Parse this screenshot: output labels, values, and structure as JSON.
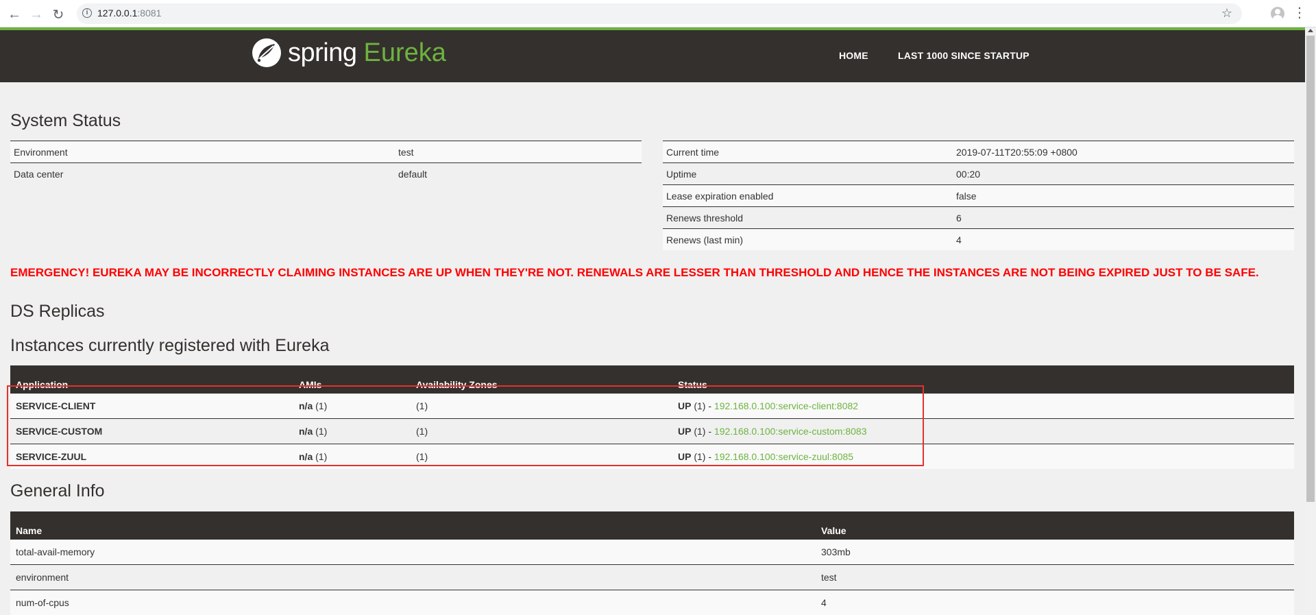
{
  "browser": {
    "url_host": "127.0.0.1",
    "url_port": ":8081"
  },
  "header": {
    "logo_spring": "spring",
    "logo_eureka": "Eureka",
    "nav": [
      "HOME",
      "LAST 1000 SINCE STARTUP"
    ]
  },
  "system_status": {
    "title": "System Status",
    "left": [
      {
        "key": "Environment",
        "value": "test"
      },
      {
        "key": "Data center",
        "value": "default"
      }
    ],
    "right": [
      {
        "key": "Current time",
        "value": "2019-07-11T20:55:09 +0800"
      },
      {
        "key": "Uptime",
        "value": "00:20"
      },
      {
        "key": "Lease expiration enabled",
        "value": "false"
      },
      {
        "key": "Renews threshold",
        "value": "6"
      },
      {
        "key": "Renews (last min)",
        "value": "4"
      }
    ]
  },
  "emergency": "EMERGENCY! EUREKA MAY BE INCORRECTLY CLAIMING INSTANCES ARE UP WHEN THEY'RE NOT. RENEWALS ARE LESSER THAN THRESHOLD AND HENCE THE INSTANCES ARE NOT BEING EXPIRED JUST TO BE SAFE.",
  "ds_replicas_title": "DS Replicas",
  "instances": {
    "title": "Instances currently registered with Eureka",
    "headers": [
      "Application",
      "AMIs",
      "Availability Zones",
      "Status"
    ],
    "rows": [
      {
        "app": "SERVICE-CLIENT",
        "ami": "n/a",
        "ami_count": "(1)",
        "zones": "(1)",
        "status": "UP",
        "status_count": "(1) -",
        "link": "192.168.0.100:service-client:8082"
      },
      {
        "app": "SERVICE-CUSTOM",
        "ami": "n/a",
        "ami_count": "(1)",
        "zones": "(1)",
        "status": "UP",
        "status_count": "(1) -",
        "link": "192.168.0.100:service-custom:8083"
      },
      {
        "app": "SERVICE-ZUUL",
        "ami": "n/a",
        "ami_count": "(1)",
        "zones": "(1)",
        "status": "UP",
        "status_count": "(1) -",
        "link": "192.168.0.100:service-zuul:8085"
      }
    ]
  },
  "general_info": {
    "title": "General Info",
    "headers": [
      "Name",
      "Value"
    ],
    "rows": [
      {
        "name": "total-avail-memory",
        "value": "303mb"
      },
      {
        "name": "environment",
        "value": "test"
      },
      {
        "name": "num-of-cpus",
        "value": "4"
      }
    ]
  },
  "colors": {
    "accent_green": "#6db33f",
    "header_bg": "#34302d",
    "emergency_red": "#ff0000",
    "highlight_box": "#e5302d"
  }
}
